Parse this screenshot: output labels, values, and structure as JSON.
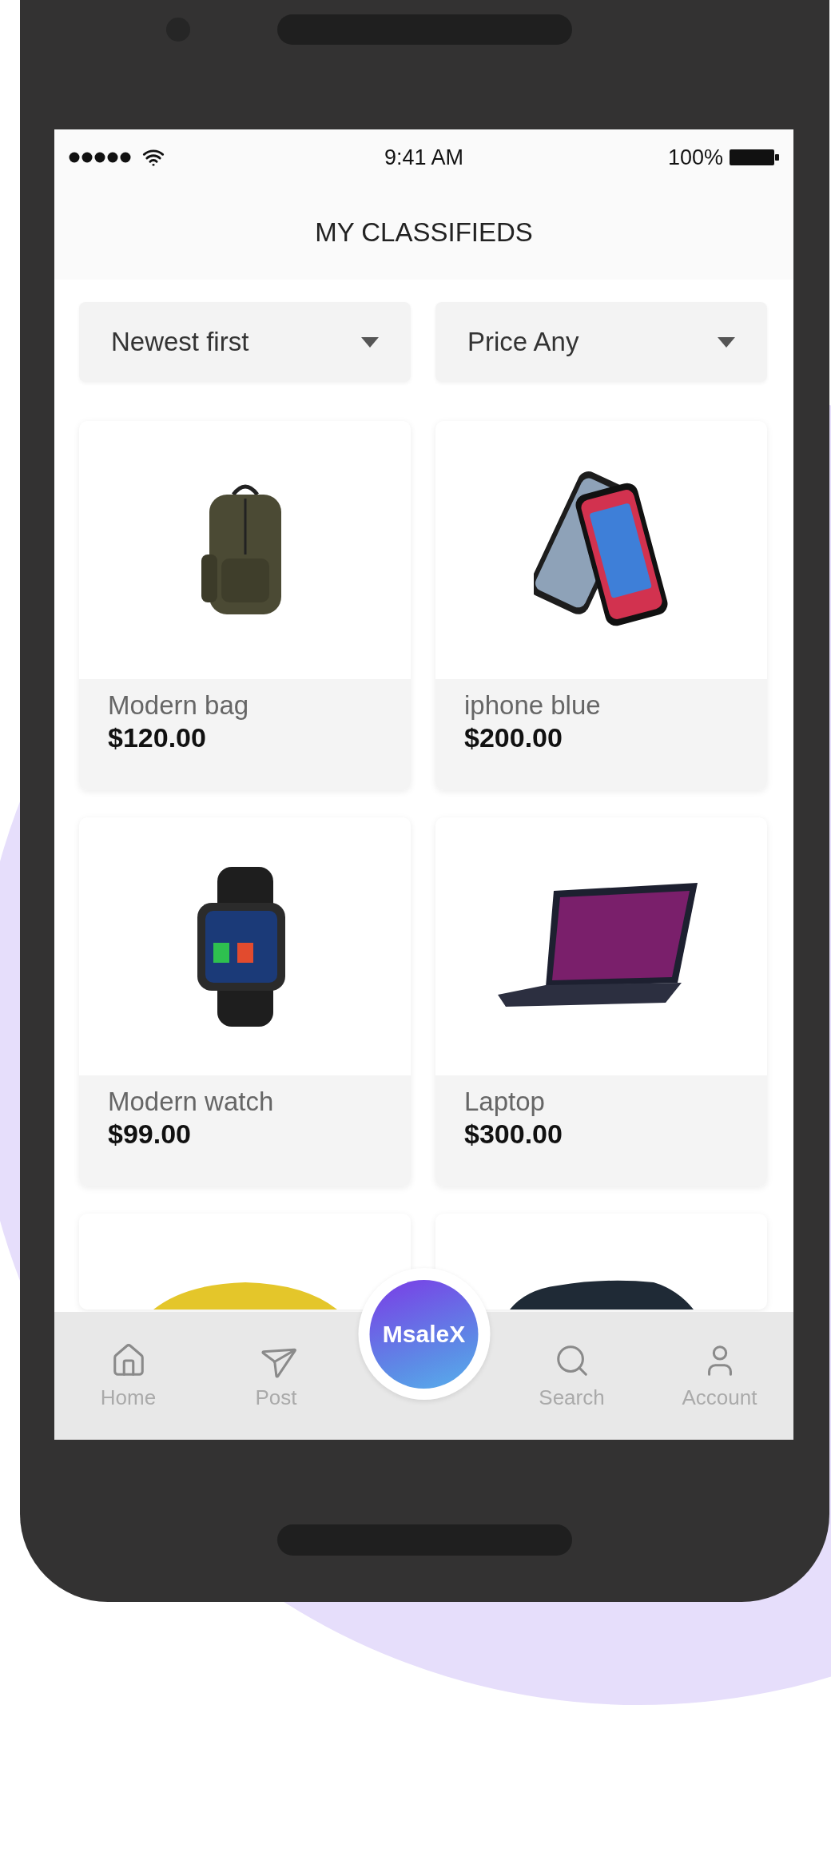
{
  "status_bar": {
    "time": "9:41 AM",
    "battery": "100%"
  },
  "header": {
    "title": "MY CLASSIFIEDS"
  },
  "filters": [
    {
      "label": "Newest first"
    },
    {
      "label": "Price Any"
    }
  ],
  "listings": [
    {
      "kind": "backpack",
      "name": "Modern bag",
      "price": "$120.00"
    },
    {
      "kind": "phones",
      "name": "iphone blue",
      "price": "$200.00"
    },
    {
      "kind": "watch",
      "name": "Modern watch",
      "price": "$99.00"
    },
    {
      "kind": "laptop",
      "name": "Laptop",
      "price": "$300.00"
    },
    {
      "kind": "sports-car"
    },
    {
      "kind": "sedan"
    }
  ],
  "nav": [
    {
      "kind": "home",
      "label": "Home"
    },
    {
      "kind": "post",
      "label": "Post"
    },
    {
      "kind": "brand",
      "label": "MsaleX"
    },
    {
      "kind": "search",
      "label": "Search"
    },
    {
      "kind": "account",
      "label": "Account"
    }
  ]
}
